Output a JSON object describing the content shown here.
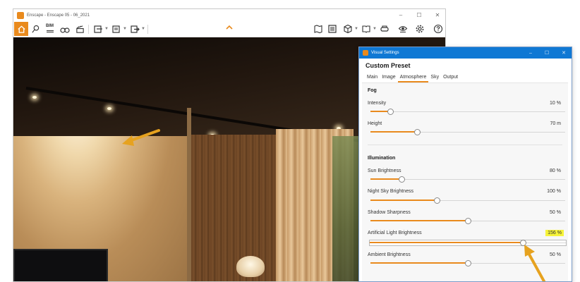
{
  "window": {
    "title": "Enscape - Enscape 05 - 06_2021",
    "controls": [
      "–",
      "☐",
      "✕"
    ]
  },
  "toolbar": {
    "icons": [
      "home-icon",
      "pin-icon",
      "bim-icon",
      "binoculars-icon",
      "clapper-icon",
      "capture-icon",
      "batch-capture-icon",
      "export-icon",
      "map-icon",
      "assets-icon",
      "cube-icon",
      "book-icon",
      "headset-icon",
      "eye-icon",
      "gear-icon",
      "help-icon"
    ],
    "bim_label": "BIM"
  },
  "dialog": {
    "title": "Visual Settings",
    "controls": [
      "–",
      "☐",
      "✕"
    ],
    "preset_name": "Custom Preset",
    "tabs": [
      "Main",
      "Image",
      "Atmosphere",
      "Sky",
      "Output"
    ],
    "active_tab": "Atmosphere",
    "fog": {
      "title": "Fog",
      "intensity": {
        "label": "Intensity",
        "value": "10 %",
        "level": 0.1
      },
      "height": {
        "label": "Height",
        "value": "70 m",
        "level": 0.24
      }
    },
    "illumination": {
      "title": "Illumination",
      "sun_brightness": {
        "label": "Sun Brightness",
        "value": "80 %",
        "level": 0.16
      },
      "night_sky_brightness": {
        "label": "Night Sky Brightness",
        "value": "100 %",
        "level": 0.34
      },
      "shadow_sharpness": {
        "label": "Shadow Sharpness",
        "value": "50 %",
        "level": 0.5
      },
      "artificial_light_brightness": {
        "label": "Artificial Light Brightness",
        "value": "156 %",
        "level": 0.78
      },
      "ambient_brightness": {
        "label": "Ambient Brightness",
        "value": "50 %",
        "level": 0.5
      }
    }
  },
  "colors": {
    "accent": "#e98a1d",
    "dialog_title_bar": "#0f78d4",
    "highlight": "#f6f33a"
  }
}
